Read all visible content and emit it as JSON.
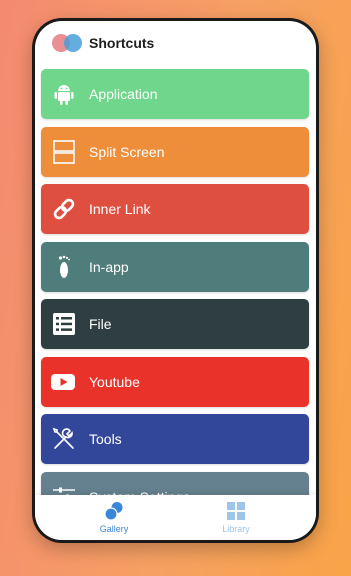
{
  "app": {
    "title": "Shortcuts"
  },
  "shortcuts": [
    {
      "label": "Application",
      "icon": "android-icon",
      "color": "#6fd68b"
    },
    {
      "label": "Split Screen",
      "icon": "split-screen-icon",
      "color": "#ee8e3b"
    },
    {
      "label": "Inner Link",
      "icon": "link-icon",
      "color": "#df4f40"
    },
    {
      "label": "In-app",
      "icon": "footprint-icon",
      "color": "#4e7d7b"
    },
    {
      "label": "File",
      "icon": "file-list-icon",
      "color": "#2f3e40"
    },
    {
      "label": "Youtube",
      "icon": "youtube-icon",
      "color": "#e8322a"
    },
    {
      "label": "Tools",
      "icon": "tools-icon",
      "color": "#33479a"
    },
    {
      "label": "System Settings",
      "icon": "sliders-icon",
      "color": "#65808e"
    }
  ],
  "bottom_nav": [
    {
      "label": "Gallery",
      "icon": "gallery-icon",
      "active": true
    },
    {
      "label": "Library",
      "icon": "library-grid-icon",
      "active": false
    }
  ],
  "colors": {
    "accent": "#3a86d8",
    "inactive": "#9ec4ea"
  }
}
